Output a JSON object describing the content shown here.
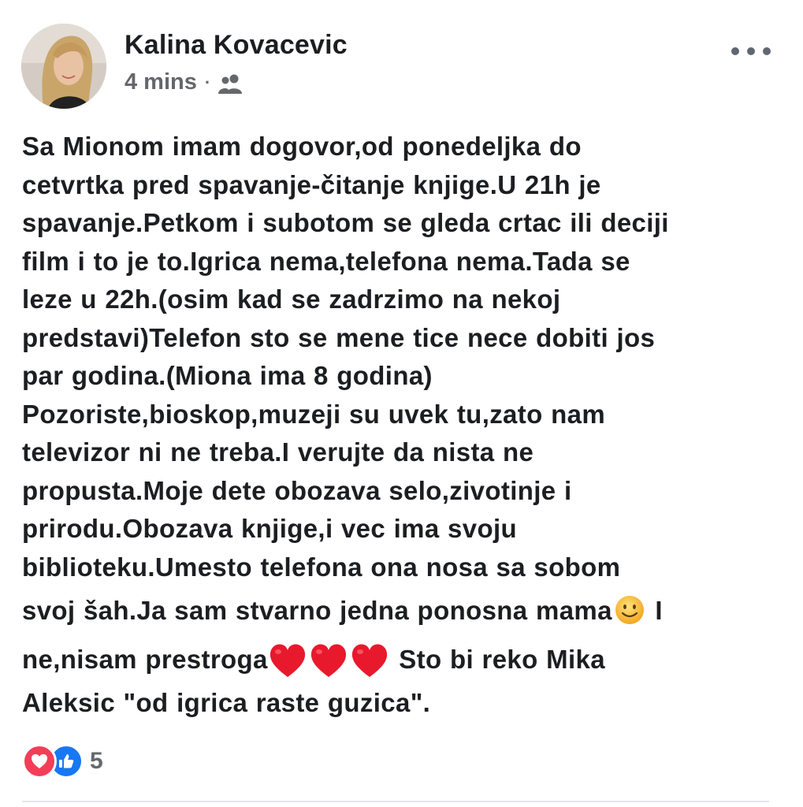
{
  "post": {
    "author": "Kalina Kovacevic",
    "timestamp": "4 mins",
    "separator": "·",
    "audience_icon": "friends-icon",
    "text_lines": [
      "Sa Mionom imam dogovor,od ponedeljka do",
      "cetvrtka pred spavanje-čitanje knjige.U 21h je",
      "spavanje.Petkom i subotom se gleda crtac ili deciji",
      "film i to je to.Igrica nema,telefona nema.Tada se",
      "leze u 22h.(osim kad se zadrzimo na nekoj",
      "predstavi)Telefon sto se mene tice nece dobiti jos",
      "par godina.(Miona ima 8 godina)",
      "Pozoriste,bioskop,muzeji su uvek tu,zato nam",
      "televizor ni ne treba.I verujte da nista ne",
      "propusta.Moje dete obozava selo,zivotinje i",
      "prirodu.Obozava knjige,i vec ima svoju",
      "biblioteku.Umesto telefona ona nosa sa sobom"
    ],
    "line13": {
      "before": "svoj šah.Ja sam stvarno jedna ponosna mama",
      "emoji": "smiling-face-emoji",
      "after": " I"
    },
    "line14": {
      "before": "ne,nisam prestroga",
      "emoji": "red-heart-emoji",
      "emoji_count": 3,
      "after": " Sto bi reko Mika"
    },
    "line15": "Aleksic \"od igrica raste guzica\".",
    "reactions": {
      "types": [
        "love",
        "like"
      ],
      "count": "5"
    },
    "colors": {
      "text": "#1c1e21",
      "meta": "#65676b",
      "love": "#f33e58",
      "like": "#1877f2",
      "heart_emoji": "#e8192c",
      "smile_emoji": "#f7c531"
    }
  }
}
